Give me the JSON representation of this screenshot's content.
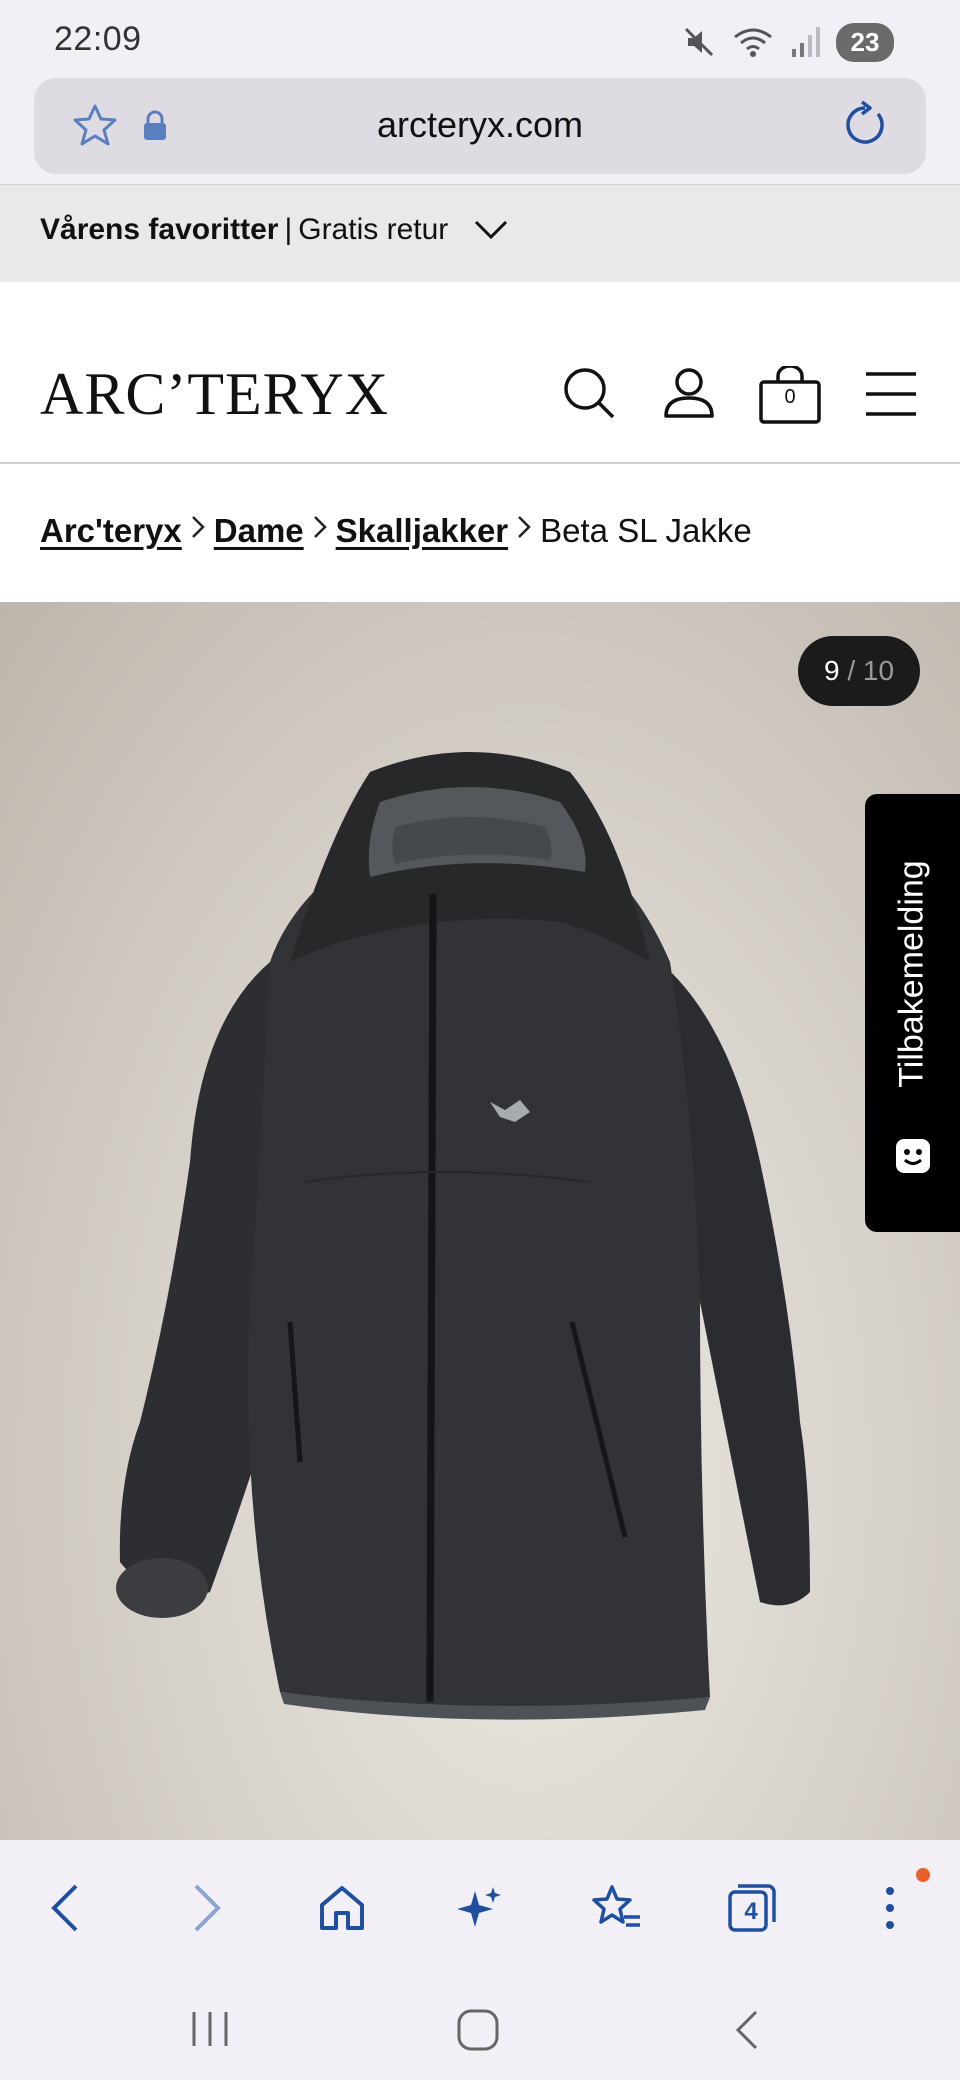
{
  "status_bar": {
    "time": "22:09",
    "battery": "23"
  },
  "browser": {
    "url": "arcteryx.com",
    "tab_count": "4"
  },
  "promo": {
    "bold": "Vårens favoritter",
    "separator": "|",
    "rest": "Gratis retur"
  },
  "header": {
    "logo": "ARC’TERYX",
    "cart_count": "0"
  },
  "breadcrumb": {
    "items": [
      {
        "label": "Arc'teryx"
      },
      {
        "label": "Dame"
      },
      {
        "label": "Skalljakker"
      }
    ],
    "current": "Beta SL Jakke"
  },
  "gallery": {
    "current": "9",
    "separator": "/",
    "total": "10"
  },
  "feedback": {
    "label": "Tilbakemelding"
  },
  "colors": {
    "accent": "#1e4fa0",
    "notification": "#e8612c",
    "browser_bg": "#f2eff6"
  }
}
